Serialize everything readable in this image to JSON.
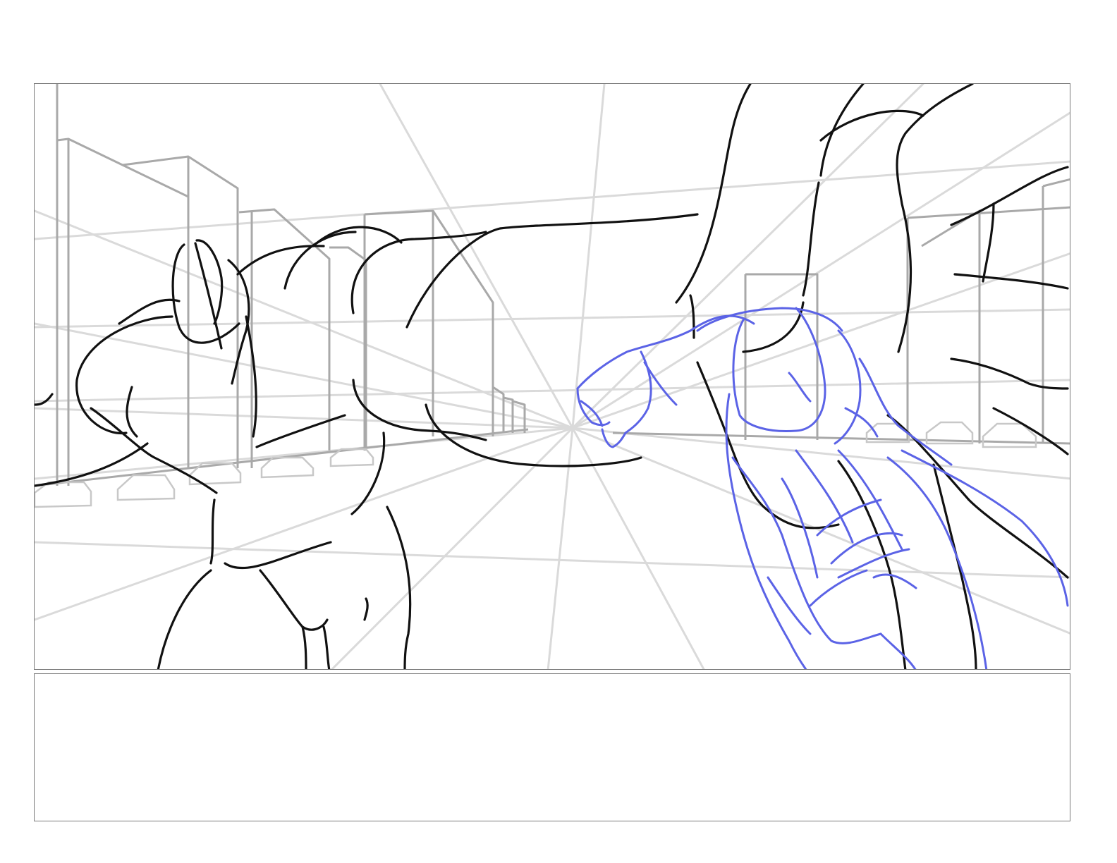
{
  "storyboard": {
    "frame_caption": "",
    "notes_text": ""
  },
  "colors": {
    "sketch_ink": "#111111",
    "blue_pencil": "#5b63e6",
    "perspective_guides": "#dadada",
    "buildings": "#a9a9a9",
    "panel_border": "#7a7a7a"
  },
  "icons": []
}
